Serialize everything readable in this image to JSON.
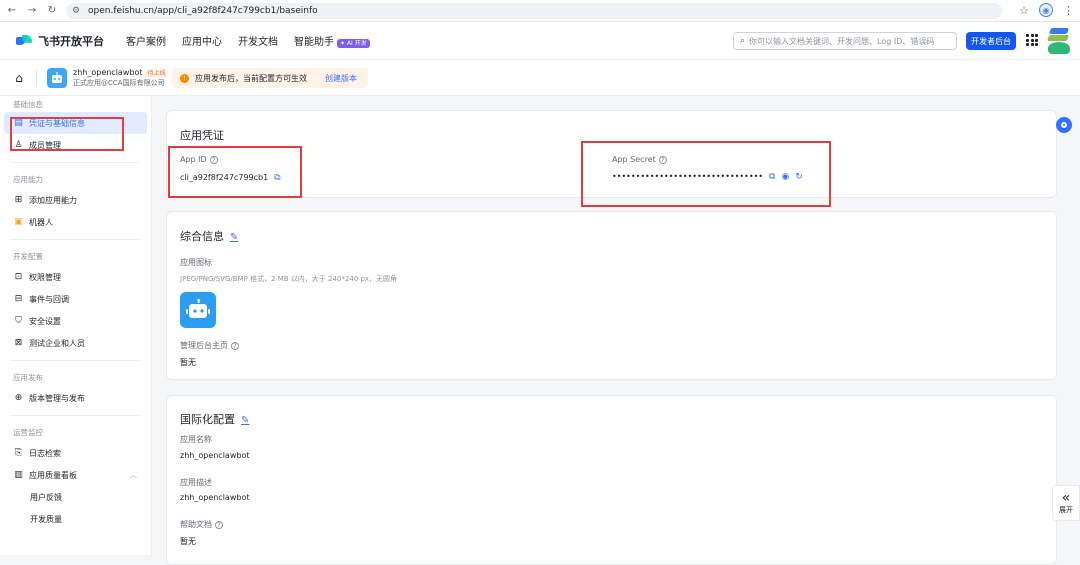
{
  "browser": {
    "url": "open.feishu.cn/app/cli_a92f8f247c799cb1/baseinfo"
  },
  "header": {
    "logo_text": "飞书开放平台",
    "nav": [
      "客户案例",
      "应用中心",
      "开发文档",
      "智能助手"
    ],
    "ai_badge": "✦ AI 开发",
    "search_placeholder": "你可以输入文档关键词、开发问题、Log ID、错误码",
    "dev_console_label": "开发者后台"
  },
  "app": {
    "name": "zhh_openclawbot",
    "status": "待上线",
    "org": "正式应用@CCA国际有限公司",
    "notice": "应用发布后，当前配置方可生效",
    "notice_link": "创建版本"
  },
  "sidebar": {
    "groups": [
      {
        "title": "基础信息",
        "items": [
          {
            "label": "凭证与基础信息",
            "icon": "id-card-icon",
            "active": true
          },
          {
            "label": "成员管理",
            "icon": "person-icon"
          }
        ]
      },
      {
        "title": "应用能力",
        "items": [
          {
            "label": "添加应用能力",
            "icon": "grid-plus-icon"
          },
          {
            "label": "机器人",
            "icon": "robot-icon"
          }
        ]
      },
      {
        "title": "开发配置",
        "items": [
          {
            "label": "权限管理",
            "icon": "lock-icon"
          },
          {
            "label": "事件与回调",
            "icon": "event-icon"
          },
          {
            "label": "安全设置",
            "icon": "shield-icon"
          },
          {
            "label": "测试企业和人员",
            "icon": "test-icon"
          }
        ]
      },
      {
        "title": "应用发布",
        "items": [
          {
            "label": "版本管理与发布",
            "icon": "upload-icon"
          }
        ]
      },
      {
        "title": "运营监控",
        "items": [
          {
            "label": "日志检索",
            "icon": "log-icon"
          },
          {
            "label": "应用质量看板",
            "icon": "chart-icon"
          }
        ],
        "subitems": [
          "用户反馈",
          "开发质量"
        ]
      }
    ]
  },
  "credentials": {
    "title": "应用凭证",
    "app_id_label": "App ID",
    "app_id_value": "cli_a92f8f247c799cb1",
    "secret_label": "App Secret",
    "secret_value": "••••••••••••••••••••••••••••••••"
  },
  "general": {
    "title": "综合信息",
    "icon_label": "应用图标",
    "icon_hint": "JPEG/PNG/SVG/BMP 格式，2 MB 以内，大于 240*240 px，无圆角",
    "homepage_label": "管理后台主页",
    "homepage_value": "暂无"
  },
  "i18n": {
    "title": "国际化配置",
    "name_label": "应用名称",
    "name_value": "zhh_openclawbot",
    "desc_label": "应用描述",
    "desc_value": "zhh_openclawbot",
    "help_label": "帮助文档",
    "help_value": "暂无"
  },
  "expand_label": "展开",
  "colors": {
    "accent": "#3370ff",
    "highlight": "#e03e3e",
    "brand_button": "#1456f0"
  }
}
